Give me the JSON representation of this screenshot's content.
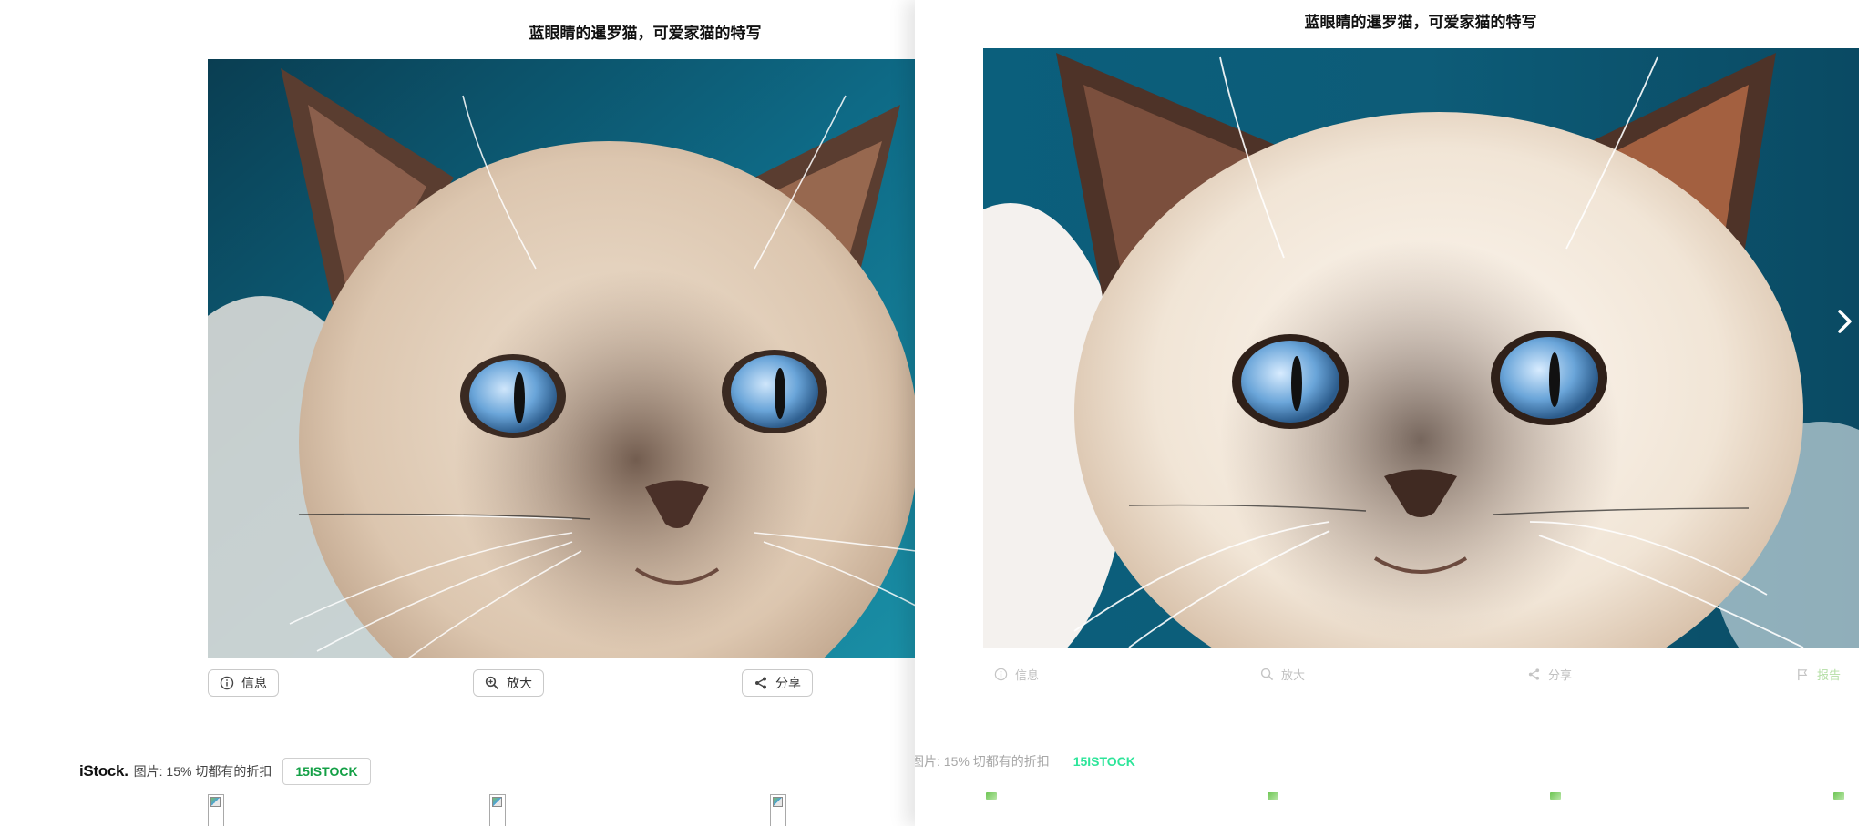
{
  "left_view": {
    "title": "蓝眼睛的暹罗猫，可爱家猫的特写",
    "actions": {
      "info": "信息",
      "zoom": "放大",
      "share": "分享"
    },
    "promo": {
      "brand": "iStock.",
      "text": "图片: 15% 切都有的折扣",
      "code": "15ISTOCK"
    }
  },
  "right_view": {
    "title": "蓝眼睛的暹罗猫，可爱家猫的特写",
    "actions": {
      "info": "信息",
      "zoom": "放大",
      "share": "分享",
      "report": "报告"
    },
    "promo": {
      "text": "图片: 15% 切都有的折扣",
      "code": "15ISTOCK"
    }
  },
  "icons": [
    "info-icon",
    "zoom-in-icon",
    "share-icon",
    "flag-icon",
    "chevron-right-icon",
    "broken-image-icon"
  ],
  "colors": {
    "promo_code": "#14a046",
    "promo_code_ghost": "#2ee59a",
    "photo_background": "#0d5f78",
    "cat_eye": "#6aa5d9"
  }
}
